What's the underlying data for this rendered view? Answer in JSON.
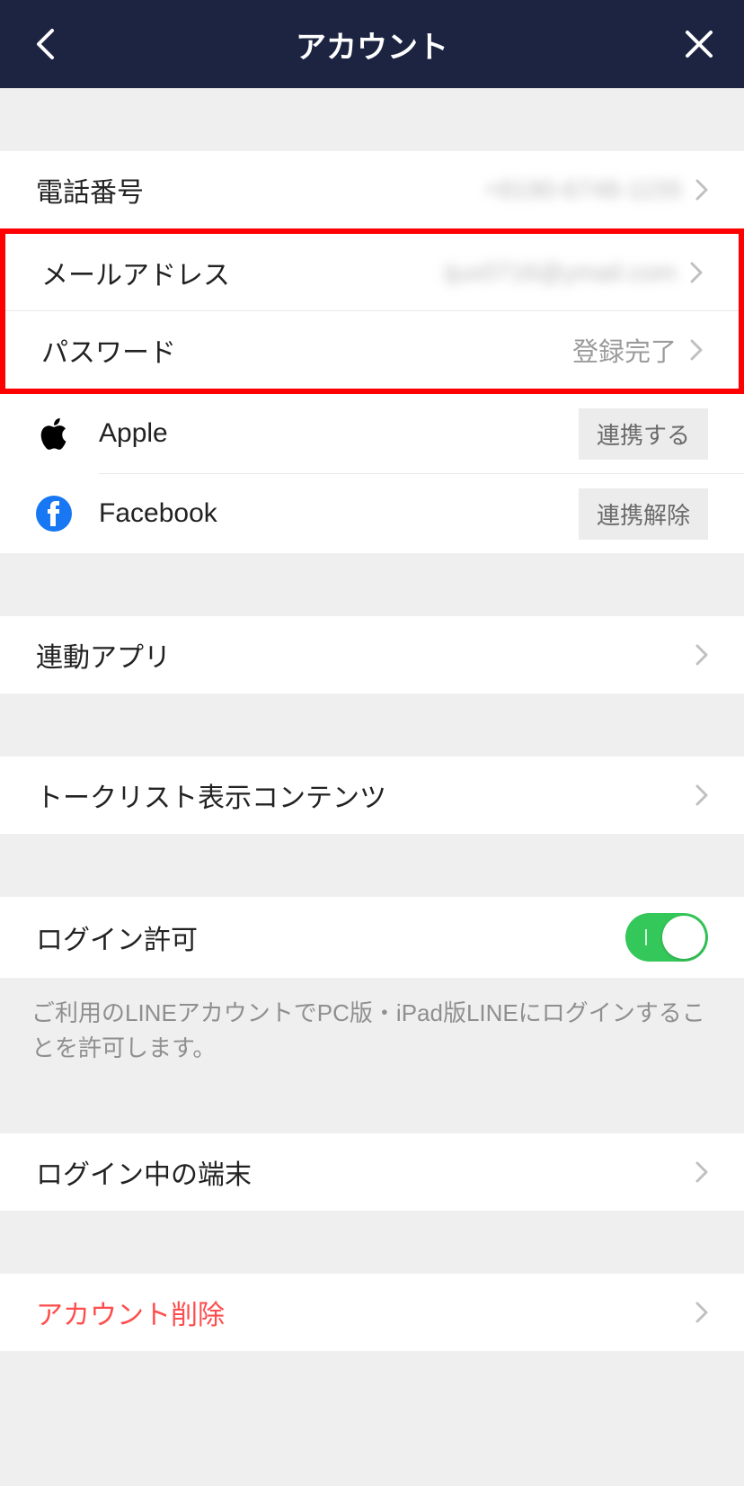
{
  "header": {
    "title": "アカウント"
  },
  "account": {
    "phone_label": "電話番号",
    "phone_value": "+8190-6748-1155",
    "email_label": "メールアドレス",
    "email_value": "ijux0716@ymail.com",
    "password_label": "パスワード",
    "password_value": "登録完了"
  },
  "linked": {
    "apple_label": "Apple",
    "apple_button": "連携する",
    "facebook_label": "Facebook",
    "facebook_button": "連携解除"
  },
  "sections": {
    "linked_apps": "連動アプリ",
    "talk_list": "トークリスト表示コンテンツ",
    "login_permission": "ログイン許可",
    "login_help": "ご利用のLINEアカウントでPC版・iPad版LINEにログインすることを許可します。",
    "logged_in_devices": "ログイン中の端末",
    "delete_account": "アカウント削除"
  }
}
